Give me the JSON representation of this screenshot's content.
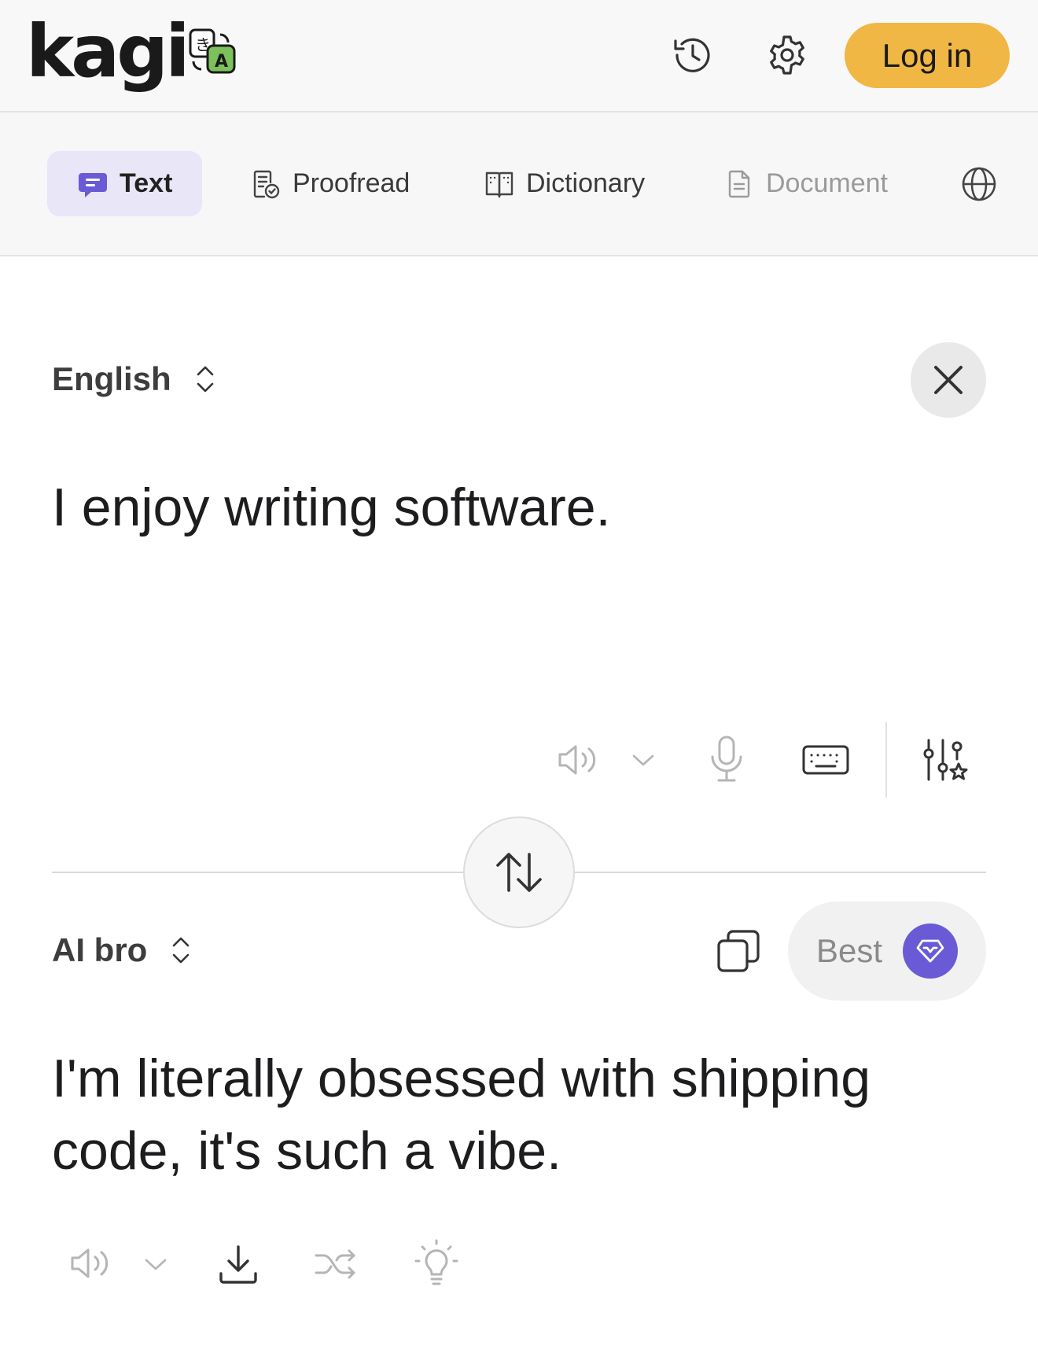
{
  "header": {
    "logo_text": "kagi",
    "login_label": "Log in"
  },
  "tabs": [
    {
      "label": "Text",
      "icon": "chat-bubble-icon",
      "active": true
    },
    {
      "label": "Proofread",
      "icon": "doc-check-icon"
    },
    {
      "label": "Dictionary",
      "icon": "book-icon"
    },
    {
      "label": "Document",
      "icon": "document-icon",
      "disabled": true
    },
    {
      "label": "",
      "icon": "globe-icon"
    }
  ],
  "source": {
    "language": "English",
    "text": "I enjoy writing software."
  },
  "target": {
    "language": "AI bro",
    "text": "I'm literally obsessed with shipping code, it's such a vibe.",
    "quality_label": "Best"
  },
  "colors": {
    "accent": "#6a5ad6",
    "login_bg": "#f1b744",
    "active_tab_bg": "#e8e6f7"
  }
}
